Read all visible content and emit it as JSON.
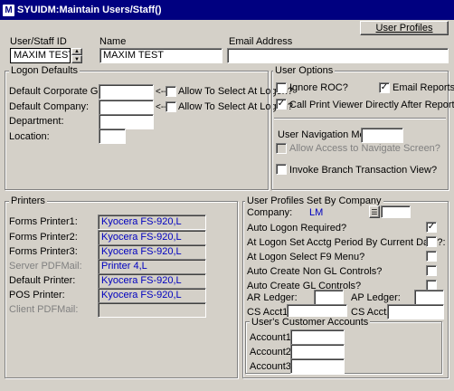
{
  "window": {
    "title": "SYUIDM:Maintain Users/Staff()",
    "icon_glyph": "M"
  },
  "header": {
    "user_profiles_button": "User Profiles",
    "user_id_label": "User/Staff ID",
    "user_id_value": "MAXIM TEST",
    "name_label": "Name",
    "name_value": "MAXIM TEST",
    "email_label": "Email Address",
    "email_value": ""
  },
  "logon_defaults": {
    "title": "Logon Defaults",
    "corporate_group_label": "Default Corporate Group:",
    "company_label": "Default Company:",
    "department_label": "Department:",
    "location_label": "Location:",
    "arrow_glyph": "<--",
    "allow_select_label": "Allow To Select At Logon?"
  },
  "user_options": {
    "title": "User Options",
    "ignore_roc": "Ignore ROC?",
    "email_reports": "Email Reports?",
    "call_print_viewer": "Call Print Viewer Directly After Report?",
    "nav_menu_label": "User Navigation Menu:",
    "allow_access_nav": "Allow Access to Navigate Screen?",
    "invoke_branch": "Invoke Branch Transaction View?",
    "checked_glyph": "✓"
  },
  "printers": {
    "title": "Printers",
    "forms1_label": "Forms Printer1:",
    "forms1_value": "Kyocera FS-920,L",
    "forms2_label": "Forms Printer2:",
    "forms2_value": "Kyocera FS-920,L",
    "forms3_label": "Forms Printer3:",
    "forms3_value": "Kyocera FS-920,L",
    "server_pdf_label": "Server PDFMail:",
    "server_pdf_value": "Printer 4,L",
    "default_label": "Default Printer:",
    "default_value": "Kyocera FS-920,L",
    "pos_label": "POS Printer:",
    "pos_value": "Kyocera FS-920,L",
    "client_pdf_label": "Client PDFMail:",
    "client_pdf_value": ""
  },
  "company_profiles": {
    "title": "User Profiles Set By Company",
    "company_label": "Company:",
    "company_value": "LM",
    "auto_logon": "Auto Logon Required?",
    "logon_set_period": "At Logon Set Acctg Period By Current Date?:",
    "logon_f9": "At Logon Select F9 Menu?",
    "auto_non_gl": "Auto Create Non GL Controls?",
    "auto_gl": "Auto Create GL Controls?",
    "ar_ledger_label": "AR Ledger:",
    "ap_ledger_label": "AP Ledger:",
    "cs_acct1_label": "CS Acct1:",
    "cs_acct2_label": "CS Acct2:"
  },
  "customer_accounts": {
    "title": "User's Customer Accounts",
    "account1_label": "Account1:",
    "account2_label": "Account2:",
    "account3_label": "Account3:"
  }
}
